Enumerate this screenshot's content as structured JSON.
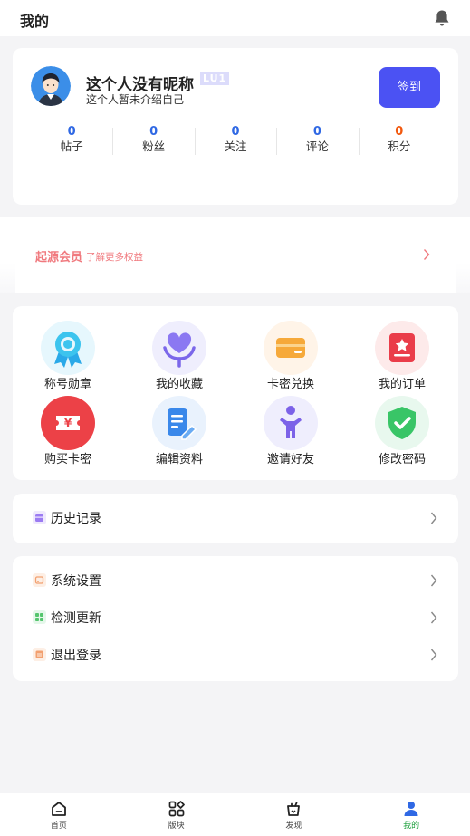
{
  "header": {
    "title": "我的"
  },
  "profile": {
    "nickname": "这个人没有昵称",
    "level": "LU1",
    "bio": "这个人暂未介绍自己",
    "signin_label": "签到",
    "stats": [
      {
        "value": "0",
        "label": "帖子"
      },
      {
        "value": "0",
        "label": "粉丝"
      },
      {
        "value": "0",
        "label": "关注"
      },
      {
        "value": "0",
        "label": "评论"
      },
      {
        "value": "0",
        "label": "积分"
      }
    ]
  },
  "membership": {
    "title": "起源会员",
    "subtitle": "了解更多权益"
  },
  "grid": [
    {
      "label": "称号勋章",
      "icon": "medal-icon"
    },
    {
      "label": "我的收藏",
      "icon": "heart-hand-icon"
    },
    {
      "label": "卡密兑换",
      "icon": "card-wallet-icon"
    },
    {
      "label": "我的订单",
      "icon": "order-icon"
    },
    {
      "label": "购买卡密",
      "icon": "ticket-yen-icon"
    },
    {
      "label": "编辑资料",
      "icon": "edit-document-icon"
    },
    {
      "label": "邀请好友",
      "icon": "invite-person-icon"
    },
    {
      "label": "修改密码",
      "icon": "shield-check-icon"
    }
  ],
  "list1": [
    {
      "label": "历史记录",
      "icon": "history-icon",
      "color": "#9b7bf2"
    }
  ],
  "list2": [
    {
      "label": "系统设置",
      "icon": "settings-icon",
      "color": "#f2a070"
    },
    {
      "label": "检测更新",
      "icon": "update-icon",
      "color": "#55c56e"
    },
    {
      "label": "退出登录",
      "icon": "logout-icon",
      "color": "#f2a070"
    }
  ],
  "tabs": [
    {
      "label": "首页",
      "icon": "home-icon"
    },
    {
      "label": "版块",
      "icon": "grid-icon"
    },
    {
      "label": "发现",
      "icon": "discover-icon"
    },
    {
      "label": "我的",
      "icon": "profile-icon",
      "active": true
    }
  ],
  "colors": {
    "accent": "#4b52f3",
    "stat_blue": "#2f68e4",
    "stat_orange": "#f2590f",
    "member_pink": "#f0797e",
    "tab_active": "#1a9f3a"
  }
}
